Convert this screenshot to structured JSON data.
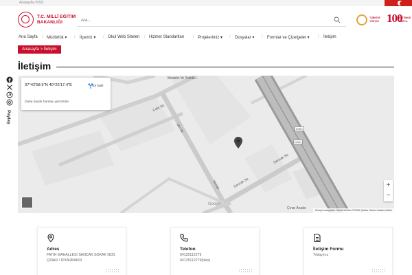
{
  "topbar": {
    "crumbs": "Anasayfa / RSS"
  },
  "header": {
    "logo_line1": "T.C. MİLLÎ EĞİTİM",
    "logo_line2": "BAKANLIĞI",
    "search_placeholder": "Ara...",
    "logo_tr_text": "TÜRKİYE YÜZYILI",
    "logo_100": "100",
    "logo_100_text": "EĞİTİMDE YÜZYIL"
  },
  "nav": {
    "items": [
      {
        "label": "Ana Sayfa"
      },
      {
        "label": "Müdürlük ▾"
      },
      {
        "label": "İlçemiz ▾"
      },
      {
        "label": "Okul Web Siteleri"
      },
      {
        "label": "Hizmet Standartları"
      },
      {
        "label": "Projelerimiz ▾"
      },
      {
        "label": "Dosyalar ▾"
      },
      {
        "label": "Formlar ve Çizelgeler ▾"
      },
      {
        "label": "İletişim"
      }
    ]
  },
  "breadcrumb": {
    "text": "Anasayfa  >  İletişim"
  },
  "page": {
    "title": "İletişim"
  },
  "social": {
    "share_label": "Paylaş"
  },
  "map": {
    "coords": "37°42'58.5\"N 40°25'17.4\"E",
    "directions_label": "Yol Tarifi",
    "bigger_map": "Daha büyük haritayı görüntüle",
    "zoom_in": "+",
    "zoom_out": "−",
    "google": "Google",
    "attribution": "Klavye kısayolları   Harita verileri ©2025   Şartlar   Harita hatası bildirin",
    "labels": {
      "top": "Mesleki Ve Teknik...",
      "road1": "Cafe Sk.",
      "road2": "Ulu Sk.",
      "road3": "Sancak Sk.",
      "road4": "Sancak Sk.",
      "road5": "Yenişe",
      "d950a": "D950",
      "d950b": "D950",
      "cinar": "Çınar Anado"
    }
  },
  "cards": [
    {
      "title": "Adres",
      "line1": "FATİH MAHALLESİ SANCAK SOKAK NOS",
      "line2": "ÇINAR / DİYARBAKIR",
      "icon": "location-pin-icon"
    },
    {
      "title": "Telefon",
      "line1": "04125112279",
      "line2": "04125112279(faks)",
      "icon": "phone-icon"
    },
    {
      "title": "İletişim Formu",
      "line1": "Tıklayınız",
      "line2": "",
      "icon": "form-icon"
    }
  ],
  "colors": {
    "brand": "#c8102e",
    "map_bg": "#ebebeb",
    "road": "#c9c9c9",
    "highway": "#9a9a9a"
  }
}
